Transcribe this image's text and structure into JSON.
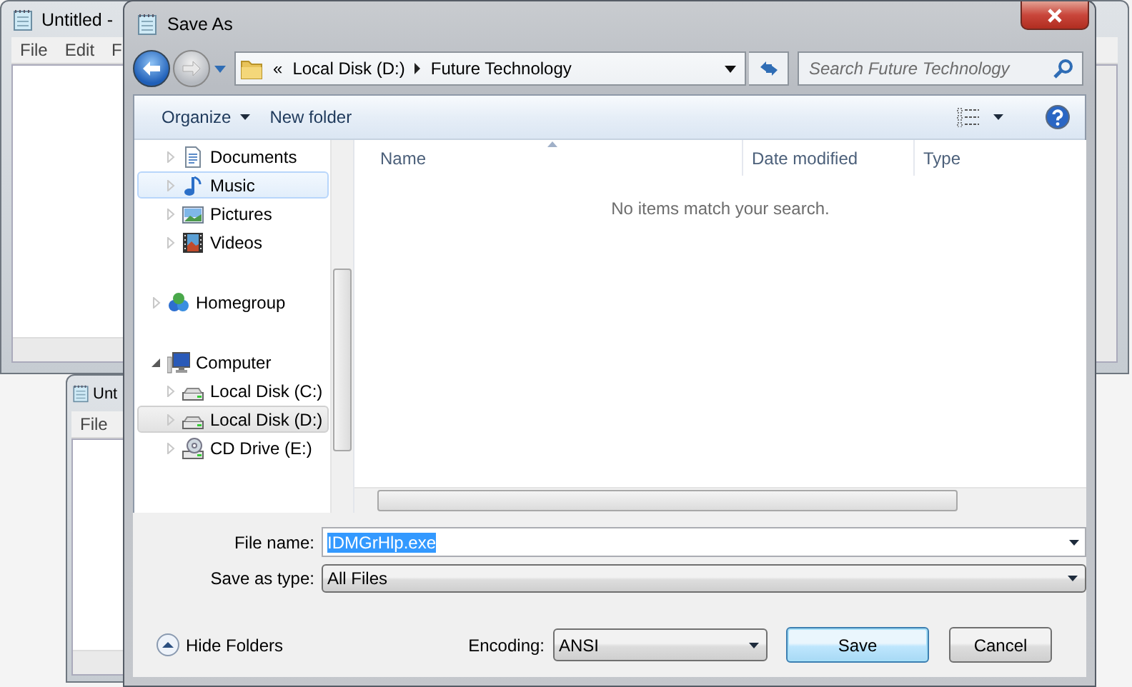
{
  "background_windows": [
    {
      "title": "Untitled -",
      "menu": [
        "File",
        "Edit",
        "F"
      ]
    },
    {
      "title": "Unt",
      "menu": [
        "File"
      ]
    }
  ],
  "dialog": {
    "title": "Save As",
    "address": {
      "overflow": "«",
      "path": [
        "Local Disk (D:)",
        "Future Technology"
      ]
    },
    "search": {
      "placeholder": "Search Future Technology"
    },
    "toolbar": [
      {
        "label": "Organize",
        "kind": "menu"
      },
      {
        "label": "New folder",
        "kind": "button"
      }
    ],
    "nav": {
      "groups": [
        {
          "items": [
            {
              "label": "Documents",
              "expanded": false,
              "selected": false,
              "hovered": false
            },
            {
              "label": "Music",
              "expanded": false,
              "selected": false,
              "hovered": true
            },
            {
              "label": "Pictures",
              "expanded": false,
              "selected": false,
              "hovered": false
            },
            {
              "label": "Videos",
              "expanded": false,
              "selected": false,
              "hovered": false
            }
          ]
        },
        {
          "items": [
            {
              "label": "Homegroup",
              "expanded": false,
              "selected": false,
              "hovered": false
            }
          ]
        },
        {
          "items": [
            {
              "label": "Computer",
              "expanded": true,
              "selected": false,
              "hovered": false,
              "children": [
                {
                  "label": "Local Disk (C:)",
                  "expanded": false,
                  "selected": false,
                  "hovered": false
                },
                {
                  "label": "Local Disk (D:)",
                  "expanded": false,
                  "selected": true,
                  "hovered": false
                },
                {
                  "label": "CD Drive (E:)",
                  "expanded": false,
                  "selected": false,
                  "hovered": false
                }
              ]
            }
          ]
        }
      ]
    },
    "columns": [
      {
        "label": "Name",
        "sorted": true
      },
      {
        "label": "Date modified",
        "sorted": false
      },
      {
        "label": "Type",
        "sorted": false
      }
    ],
    "empty_message": "No items match your search.",
    "file_name": {
      "label": "File name:",
      "value": "IDMGrHlp.exe",
      "text_selected": true
    },
    "save_as_type": {
      "label": "Save as type:",
      "value": "All Files"
    },
    "hide_folders": "Hide Folders",
    "encoding": {
      "label": "Encoding:",
      "value": "ANSI"
    },
    "buttons": [
      {
        "label": "Save",
        "default": true
      },
      {
        "label": "Cancel",
        "default": false
      }
    ]
  }
}
